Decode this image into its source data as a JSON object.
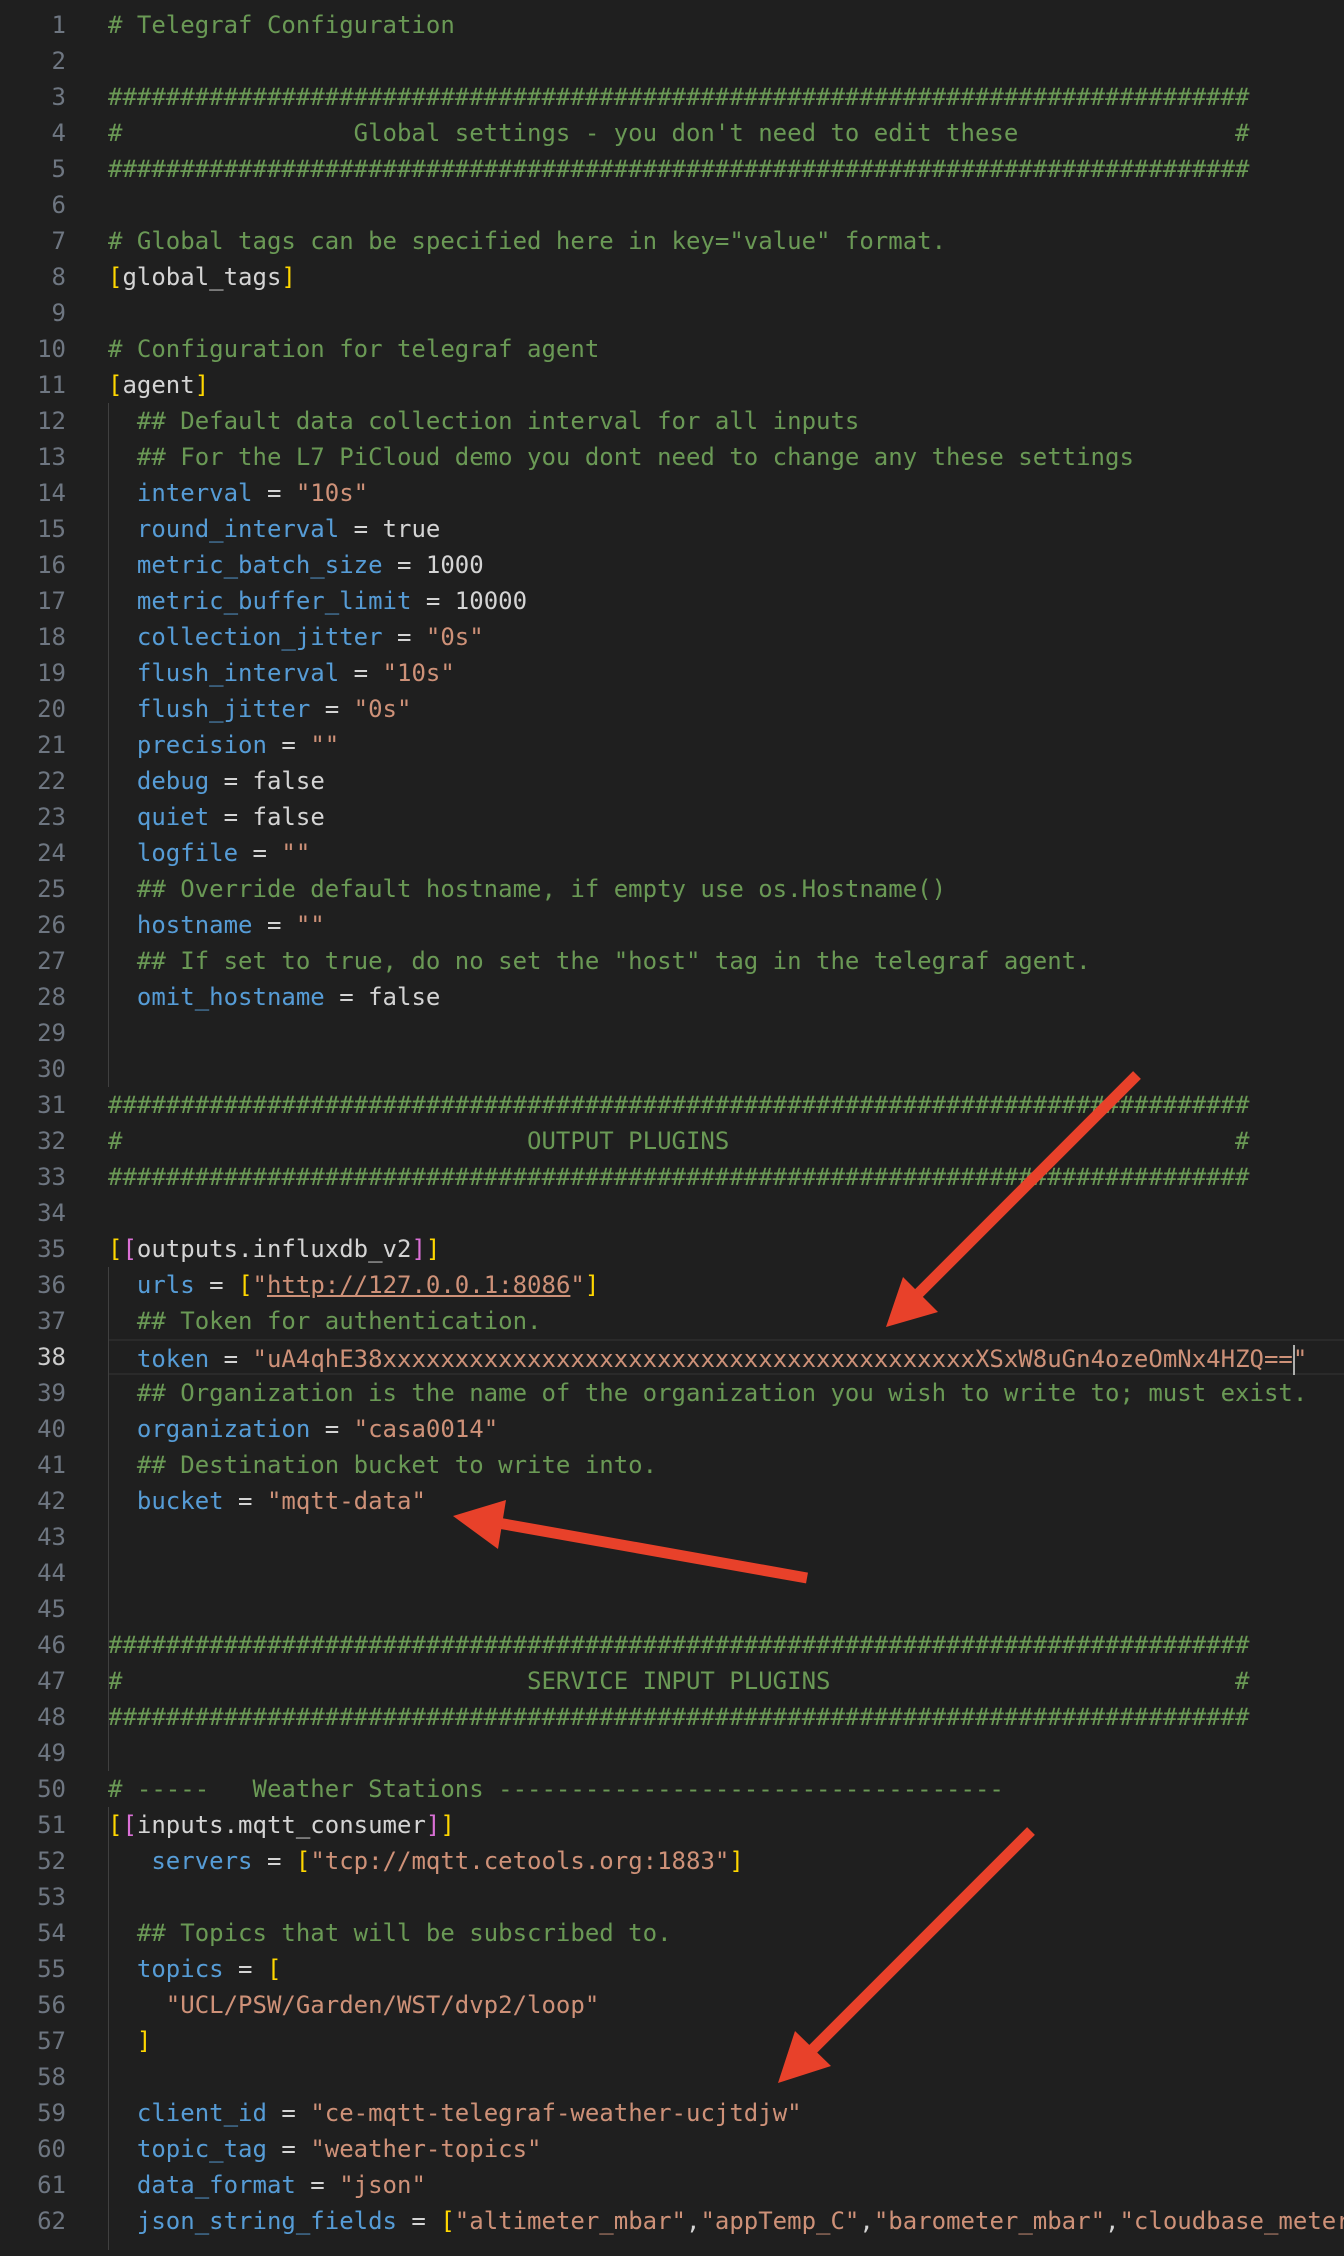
{
  "editor": {
    "language": "toml",
    "current_line": 38,
    "lines": [
      {
        "n": "1",
        "segs": [
          {
            "t": "# Telegraf Configuration",
            "c": "c"
          }
        ]
      },
      {
        "n": "2",
        "segs": []
      },
      {
        "n": "3",
        "segs": [
          {
            "t": "###############################################################################",
            "c": "c"
          }
        ]
      },
      {
        "n": "4",
        "segs": [
          {
            "t": "#                Global settings - you don't need to edit these               #",
            "c": "c"
          }
        ]
      },
      {
        "n": "5",
        "segs": [
          {
            "t": "###############################################################################",
            "c": "c"
          }
        ]
      },
      {
        "n": "6",
        "segs": []
      },
      {
        "n": "7",
        "segs": [
          {
            "t": "# Global tags can be specified here in key=\"value\" format.",
            "c": "c"
          }
        ]
      },
      {
        "n": "8",
        "segs": [
          {
            "t": "[",
            "c": "b1"
          },
          {
            "t": "global_tags",
            "c": "t"
          },
          {
            "t": "]",
            "c": "b1"
          }
        ]
      },
      {
        "n": "9",
        "segs": []
      },
      {
        "n": "10",
        "segs": [
          {
            "t": "# Configuration for telegraf agent",
            "c": "c"
          }
        ]
      },
      {
        "n": "11",
        "segs": [
          {
            "t": "[",
            "c": "b1"
          },
          {
            "t": "agent",
            "c": "t"
          },
          {
            "t": "]",
            "c": "b1"
          }
        ]
      },
      {
        "n": "12",
        "segs": [
          {
            "t": "  ## Default data collection interval for all inputs",
            "c": "c"
          }
        ]
      },
      {
        "n": "13",
        "segs": [
          {
            "t": "  ## For the L7 PiCloud demo you dont need to change any these settings",
            "c": "c"
          }
        ]
      },
      {
        "n": "14",
        "segs": [
          {
            "t": "  interval",
            "c": "k"
          },
          {
            "t": " = ",
            "c": "p"
          },
          {
            "t": "\"10s\"",
            "c": "s"
          }
        ]
      },
      {
        "n": "15",
        "segs": [
          {
            "t": "  round_interval",
            "c": "k"
          },
          {
            "t": " = ",
            "c": "p"
          },
          {
            "t": "true",
            "c": "t"
          }
        ]
      },
      {
        "n": "16",
        "segs": [
          {
            "t": "  metric_batch_size",
            "c": "k"
          },
          {
            "t": " = ",
            "c": "p"
          },
          {
            "t": "1000",
            "c": "t"
          }
        ]
      },
      {
        "n": "17",
        "segs": [
          {
            "t": "  metric_buffer_limit",
            "c": "k"
          },
          {
            "t": " = ",
            "c": "p"
          },
          {
            "t": "10000",
            "c": "t"
          }
        ]
      },
      {
        "n": "18",
        "segs": [
          {
            "t": "  collection_jitter",
            "c": "k"
          },
          {
            "t": " = ",
            "c": "p"
          },
          {
            "t": "\"0s\"",
            "c": "s"
          }
        ]
      },
      {
        "n": "19",
        "segs": [
          {
            "t": "  flush_interval",
            "c": "k"
          },
          {
            "t": " = ",
            "c": "p"
          },
          {
            "t": "\"10s\"",
            "c": "s"
          }
        ]
      },
      {
        "n": "20",
        "segs": [
          {
            "t": "  flush_jitter",
            "c": "k"
          },
          {
            "t": " = ",
            "c": "p"
          },
          {
            "t": "\"0s\"",
            "c": "s"
          }
        ]
      },
      {
        "n": "21",
        "segs": [
          {
            "t": "  precision",
            "c": "k"
          },
          {
            "t": " = ",
            "c": "p"
          },
          {
            "t": "\"\"",
            "c": "s"
          }
        ]
      },
      {
        "n": "22",
        "segs": [
          {
            "t": "  debug",
            "c": "k"
          },
          {
            "t": " = ",
            "c": "p"
          },
          {
            "t": "false",
            "c": "t"
          }
        ]
      },
      {
        "n": "23",
        "segs": [
          {
            "t": "  quiet",
            "c": "k"
          },
          {
            "t": " = ",
            "c": "p"
          },
          {
            "t": "false",
            "c": "t"
          }
        ]
      },
      {
        "n": "24",
        "segs": [
          {
            "t": "  logfile",
            "c": "k"
          },
          {
            "t": " = ",
            "c": "p"
          },
          {
            "t": "\"\"",
            "c": "s"
          }
        ]
      },
      {
        "n": "25",
        "segs": [
          {
            "t": "  ## Override default hostname, if empty use os.Hostname()",
            "c": "c"
          }
        ]
      },
      {
        "n": "26",
        "segs": [
          {
            "t": "  hostname",
            "c": "k"
          },
          {
            "t": " = ",
            "c": "p"
          },
          {
            "t": "\"\"",
            "c": "s"
          }
        ]
      },
      {
        "n": "27",
        "segs": [
          {
            "t": "  ## If set to true, do no set the \"host\" tag in the telegraf agent.",
            "c": "c"
          }
        ]
      },
      {
        "n": "28",
        "segs": [
          {
            "t": "  omit_hostname",
            "c": "k"
          },
          {
            "t": " = ",
            "c": "p"
          },
          {
            "t": "false",
            "c": "t"
          }
        ]
      },
      {
        "n": "29",
        "segs": []
      },
      {
        "n": "30",
        "segs": []
      },
      {
        "n": "31",
        "segs": [
          {
            "t": "###############################################################################",
            "c": "c"
          }
        ]
      },
      {
        "n": "32",
        "segs": [
          {
            "t": "#                            OUTPUT PLUGINS                                   #",
            "c": "c"
          }
        ]
      },
      {
        "n": "33",
        "segs": [
          {
            "t": "###############################################################################",
            "c": "c"
          }
        ]
      },
      {
        "n": "34",
        "segs": []
      },
      {
        "n": "35",
        "segs": [
          {
            "t": "[",
            "c": "b1"
          },
          {
            "t": "[",
            "c": "b2"
          },
          {
            "t": "outputs.influxdb_v2",
            "c": "t"
          },
          {
            "t": "]",
            "c": "b2"
          },
          {
            "t": "]",
            "c": "b1"
          }
        ]
      },
      {
        "n": "36",
        "segs": [
          {
            "t": "  urls",
            "c": "k"
          },
          {
            "t": " = ",
            "c": "p"
          },
          {
            "t": "[",
            "c": "b1"
          },
          {
            "t": "\"",
            "c": "s"
          },
          {
            "t": "http://127.0.0.1:8086",
            "c": "s u"
          },
          {
            "t": "\"",
            "c": "s"
          },
          {
            "t": "]",
            "c": "b1"
          }
        ]
      },
      {
        "n": "37",
        "segs": [
          {
            "t": "  ## Token for authentication.",
            "c": "c"
          }
        ]
      },
      {
        "n": "38",
        "segs": [
          {
            "t": "  token",
            "c": "k"
          },
          {
            "t": " = ",
            "c": "p"
          },
          {
            "t": "\"uA4qhE38xxxxxxxxxxxxxxxxxxxxxxxxxxxxxxxxxxxxxxxxxXSxW8uGn4ozeOmNx4HZQ==",
            "c": "s"
          },
          {
            "t": "",
            "c": "cursor"
          },
          {
            "t": "\"",
            "c": "s"
          }
        ]
      },
      {
        "n": "39",
        "segs": [
          {
            "t": "  ## Organization is the name of the organization you wish to write to; must exist.",
            "c": "c"
          }
        ]
      },
      {
        "n": "40",
        "segs": [
          {
            "t": "  organization",
            "c": "k"
          },
          {
            "t": " = ",
            "c": "p"
          },
          {
            "t": "\"casa0014\"",
            "c": "s"
          }
        ]
      },
      {
        "n": "41",
        "segs": [
          {
            "t": "  ## Destination bucket to write into.",
            "c": "c"
          }
        ]
      },
      {
        "n": "42",
        "segs": [
          {
            "t": "  bucket",
            "c": "k"
          },
          {
            "t": " = ",
            "c": "p"
          },
          {
            "t": "\"mqtt-data\"",
            "c": "s"
          }
        ]
      },
      {
        "n": "43",
        "segs": []
      },
      {
        "n": "44",
        "segs": []
      },
      {
        "n": "45",
        "segs": []
      },
      {
        "n": "46",
        "segs": [
          {
            "t": "###############################################################################",
            "c": "c"
          }
        ]
      },
      {
        "n": "47",
        "segs": [
          {
            "t": "#                            SERVICE INPUT PLUGINS                            #",
            "c": "c"
          }
        ]
      },
      {
        "n": "48",
        "segs": [
          {
            "t": "###############################################################################",
            "c": "c"
          }
        ]
      },
      {
        "n": "49",
        "segs": []
      },
      {
        "n": "50",
        "segs": [
          {
            "t": "# -----   Weather Stations -----------------------------------",
            "c": "c"
          }
        ]
      },
      {
        "n": "51",
        "segs": [
          {
            "t": "[",
            "c": "b1"
          },
          {
            "t": "[",
            "c": "b2"
          },
          {
            "t": "inputs.mqtt_consumer",
            "c": "t"
          },
          {
            "t": "]",
            "c": "b2"
          },
          {
            "t": "]",
            "c": "b1"
          }
        ]
      },
      {
        "n": "52",
        "segs": [
          {
            "t": "   servers",
            "c": "k"
          },
          {
            "t": " = ",
            "c": "p"
          },
          {
            "t": "[",
            "c": "b1"
          },
          {
            "t": "\"tcp://mqtt.cetools.org:1883\"",
            "c": "s"
          },
          {
            "t": "]",
            "c": "b1"
          }
        ]
      },
      {
        "n": "53",
        "segs": []
      },
      {
        "n": "54",
        "segs": [
          {
            "t": "  ## Topics that will be subscribed to.",
            "c": "c"
          }
        ]
      },
      {
        "n": "55",
        "segs": [
          {
            "t": "  topics",
            "c": "k"
          },
          {
            "t": " = ",
            "c": "p"
          },
          {
            "t": "[",
            "c": "b1"
          }
        ]
      },
      {
        "n": "56",
        "segs": [
          {
            "t": "    \"UCL/PSW/Garden/WST/dvp2/loop\"",
            "c": "s"
          }
        ]
      },
      {
        "n": "57",
        "segs": [
          {
            "t": "  ",
            "c": "p"
          },
          {
            "t": "]",
            "c": "b1"
          }
        ]
      },
      {
        "n": "58",
        "segs": []
      },
      {
        "n": "59",
        "segs": [
          {
            "t": "  client_id",
            "c": "k"
          },
          {
            "t": " = ",
            "c": "p"
          },
          {
            "t": "\"ce-mqtt-telegraf-weather-ucjtdjw\"",
            "c": "s"
          }
        ]
      },
      {
        "n": "60",
        "segs": [
          {
            "t": "  topic_tag",
            "c": "k"
          },
          {
            "t": " = ",
            "c": "p"
          },
          {
            "t": "\"weather-topics\"",
            "c": "s"
          }
        ]
      },
      {
        "n": "61",
        "segs": [
          {
            "t": "  data_format",
            "c": "k"
          },
          {
            "t": " = ",
            "c": "p"
          },
          {
            "t": "\"json\"",
            "c": "s"
          }
        ]
      },
      {
        "n": "62",
        "segs": [
          {
            "t": "  json_string_fields",
            "c": "k"
          },
          {
            "t": " = ",
            "c": "p"
          },
          {
            "t": "[",
            "c": "b1"
          },
          {
            "t": "\"altimeter_mbar\"",
            "c": "s"
          },
          {
            "t": ",",
            "c": "p"
          },
          {
            "t": "\"appTemp_C\"",
            "c": "s"
          },
          {
            "t": ",",
            "c": "p"
          },
          {
            "t": "\"barometer_mbar\"",
            "c": "s"
          },
          {
            "t": ",",
            "c": "p"
          },
          {
            "t": "\"cloudbase_meter",
            "c": "s"
          }
        ]
      }
    ]
  },
  "annotations": [
    {
      "name": "arrow-to-token",
      "points_to": "token",
      "color": "#e8412a"
    },
    {
      "name": "arrow-to-bucket",
      "points_to": "bucket",
      "color": "#e8412a"
    },
    {
      "name": "arrow-to-client-id",
      "points_to": "client_id",
      "color": "#e8412a"
    }
  ],
  "theme": {
    "background": "#1f1f1f",
    "comment": "#6a9955",
    "key": "#569cd6",
    "string": "#ce9178",
    "bracket_outer": "#ffd700",
    "bracket_inner": "#da70d6",
    "annotation": "#e8412a"
  }
}
